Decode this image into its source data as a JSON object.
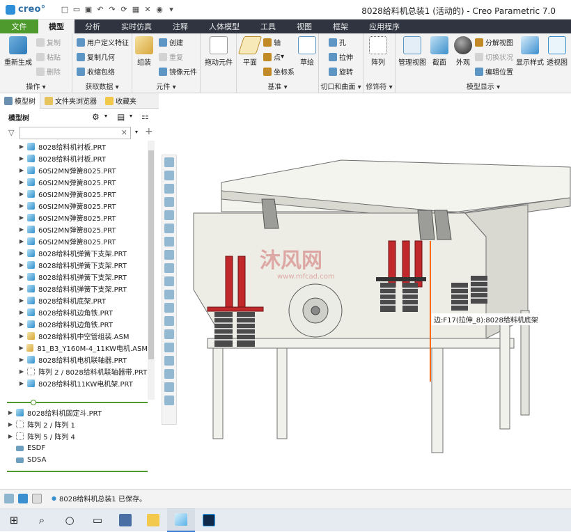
{
  "app": {
    "brand": "creo°",
    "window_title": "8028给料机总装1 (活动的) - Creo Parametric 7.0"
  },
  "quick_access": [
    "new-icon",
    "open-icon",
    "save-icon",
    "undo-icon",
    "redo-icon",
    "regenerate-icon",
    "window-icon",
    "close-window-icon",
    "appearance-icon",
    "customize-icon"
  ],
  "tabs": [
    "文件",
    "模型",
    "分析",
    "实时仿真",
    "注释",
    "人体模型",
    "工具",
    "视图",
    "框架",
    "应用程序"
  ],
  "ribbon": {
    "operations": {
      "title": "操作",
      "regenerate": "重新生成",
      "copy": "复制",
      "paste": "粘贴",
      "delete": "删除"
    },
    "get_data": {
      "title": "获取数据",
      "udf": "用户定义特征",
      "copy_geom": "复制几何",
      "shrinkwrap": "收缩包络"
    },
    "component": {
      "title": "元件",
      "assemble": "组装",
      "create": "创建",
      "repeat": "重复",
      "mirror": "镜像元件"
    },
    "drag": {
      "label": "拖动元件"
    },
    "datum": {
      "title": "基准",
      "plane": "平面",
      "axis": "轴",
      "point": "点",
      "csys": "坐标系",
      "sketch": "草绘"
    },
    "cut_surface": {
      "title": "切口和曲面",
      "hole": "孔",
      "extrude": "拉伸",
      "revolve": "旋转"
    },
    "modifiers": {
      "title": "修饰符",
      "pattern": "阵列"
    },
    "model_display": {
      "title": "模型显示",
      "manage_views": "管理视图",
      "section": "截面",
      "appearance": "外观",
      "explode": "分解视图",
      "toggle_state": "切换状况",
      "edit_position": "编辑位置",
      "display_style": "显示样式",
      "perspective": "透视图"
    }
  },
  "left_panel": {
    "tabs": [
      "模型树",
      "文件夹浏览器",
      "收藏夹"
    ],
    "tree_title": "模型树",
    "items": [
      {
        "label": "8028给料机衬板.PRT",
        "kind": "part"
      },
      {
        "label": "8028给料机衬板.PRT",
        "kind": "part"
      },
      {
        "label": "60SI2MN弹簧8025.PRT",
        "kind": "part"
      },
      {
        "label": "60SI2MN弹簧8025.PRT",
        "kind": "part"
      },
      {
        "label": "60SI2MN弹簧8025.PRT",
        "kind": "part"
      },
      {
        "label": "60SI2MN弹簧8025.PRT",
        "kind": "part"
      },
      {
        "label": "60SI2MN弹簧8025.PRT",
        "kind": "part"
      },
      {
        "label": "60SI2MN弹簧8025.PRT",
        "kind": "part"
      },
      {
        "label": "60SI2MN弹簧8025.PRT",
        "kind": "part"
      },
      {
        "label": "8028给料机弹簧下支架.PRT",
        "kind": "part"
      },
      {
        "label": "8028给料机弹簧下支架.PRT",
        "kind": "part"
      },
      {
        "label": "8028给料机弹簧下支架.PRT",
        "kind": "part"
      },
      {
        "label": "8028给料机弹簧下支架.PRT",
        "kind": "part"
      },
      {
        "label": "8028给料机底架.PRT",
        "kind": "part"
      },
      {
        "label": "8028给料机边角铁.PRT",
        "kind": "part"
      },
      {
        "label": "8028给料机边角铁.PRT",
        "kind": "part"
      },
      {
        "label": "8028给料机中空管组装.ASM",
        "kind": "asm"
      },
      {
        "label": "81_B3_Y160M-4_11KW电机.ASM",
        "kind": "asm"
      },
      {
        "label": "8028给料机电机联轴器.PRT",
        "kind": "part"
      },
      {
        "label": "阵列 2 / 8028给料机联轴器带.PRT",
        "kind": "pattern"
      },
      {
        "label": "8028给料机11KW电机架.PRT",
        "kind": "part"
      }
    ],
    "items_lower": [
      {
        "label": "8028给料机固定斗.PRT",
        "kind": "part"
      },
      {
        "label": "阵列 2 / 阵列 1",
        "kind": "pattern"
      },
      {
        "label": "阵列 5 / 阵列 4",
        "kind": "pattern"
      },
      {
        "label": "ESDF",
        "kind": "feat"
      },
      {
        "label": "SDSA",
        "kind": "feat"
      }
    ]
  },
  "graphics": {
    "watermark_name": "沐风网",
    "watermark_url": "www.mfcad.com",
    "hover_tip": "边:F17(拉伸_8):8028给料机底架"
  },
  "status": {
    "message": "8028给料机总装1 已保存。"
  },
  "taskbar": [
    "windows-start-icon",
    "search-icon",
    "cortana-icon",
    "task-view-icon",
    "calculator-icon",
    "file-explorer-icon",
    "creo-icon",
    "photoshop-icon"
  ],
  "colors": {
    "file_tab": "#4e9a2d",
    "tabbar": "#2f3440",
    "spring_red": "#c0282b",
    "accent_blue": "#2f8ecb"
  }
}
